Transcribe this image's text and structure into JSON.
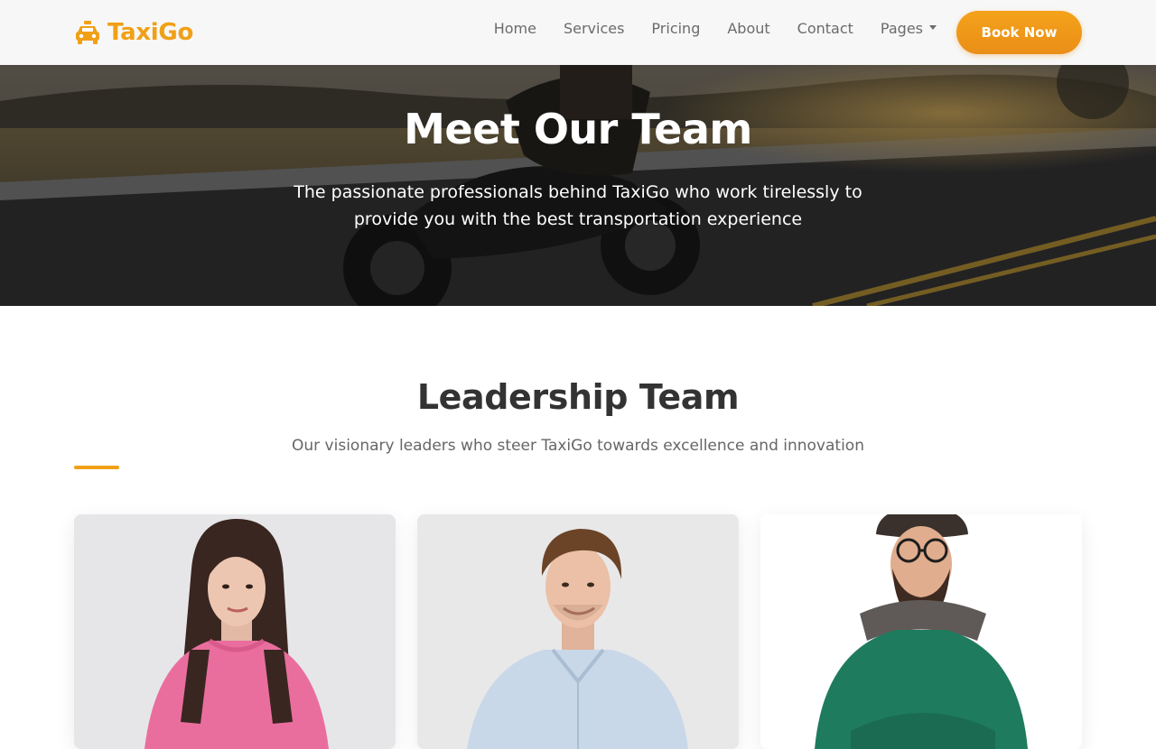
{
  "brand": {
    "name": "TaxiGo",
    "icon": "taxi-icon",
    "color": "#f0a017"
  },
  "nav": {
    "links": [
      {
        "label": "Home"
      },
      {
        "label": "Services"
      },
      {
        "label": "Pricing"
      },
      {
        "label": "About"
      },
      {
        "label": "Contact"
      },
      {
        "label": "Pages",
        "dropdown": true
      }
    ],
    "cta_label": "Book Now"
  },
  "hero": {
    "title": "Meet Our Team",
    "subtitle": "The passionate professionals behind TaxiGo who work tirelessly to provide you with the best transportation experience"
  },
  "leadership": {
    "title": "Leadership Team",
    "subtitle": "Our visionary leaders who steer TaxiGo towards excellence and innovation"
  },
  "team_cards": [
    {
      "photo": "woman-portrait-pink-sweater"
    },
    {
      "photo": "man-portrait-light-shirt"
    },
    {
      "photo": "bearded-man-portrait-green-sweater"
    }
  ],
  "colors": {
    "accent": "#f0a017",
    "cta_start": "#f4a21b",
    "cta_end": "#ea8e17",
    "heading": "#333333",
    "muted": "#666666"
  }
}
